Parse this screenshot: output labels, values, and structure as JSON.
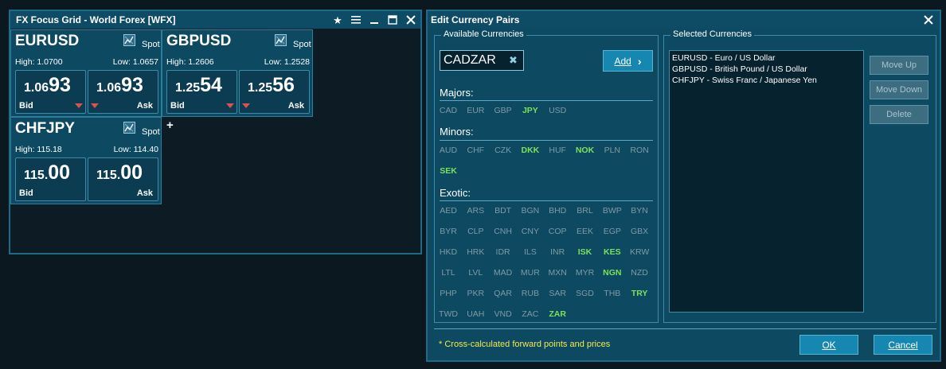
{
  "fx_window": {
    "title": "FX Focus Grid - World Forex [WFX]",
    "controls": [
      "star-icon",
      "menu-icon",
      "minimize-icon",
      "maximize-icon",
      "close-icon"
    ],
    "tiles": [
      {
        "symbol": "EURUSD",
        "spot": "Spot",
        "high": "High: 1.0700",
        "low": "Low: 1.0657",
        "bid": {
          "small": "1.06",
          "big": "93",
          "label": "Bid",
          "tick": "down"
        },
        "ask": {
          "small": "1.06",
          "big": "93",
          "label": "Ask",
          "tick": "down"
        }
      },
      {
        "symbol": "GBPUSD",
        "spot": "Spot",
        "high": "High: 1.2606",
        "low": "Low: 1.2528",
        "bid": {
          "small": "1.25",
          "big": "54",
          "label": "Bid",
          "tick": "down"
        },
        "ask": {
          "small": "1.25",
          "big": "56",
          "label": "Ask",
          "tick": "down"
        }
      },
      {
        "symbol": "CHFJPY",
        "spot": "Spot",
        "high": "High: 115.18",
        "low": "Low: 114.40",
        "bid": {
          "small": "115.",
          "big": "00",
          "label": "Bid",
          "tick": "none"
        },
        "ask": {
          "small": "115.",
          "big": "00",
          "label": "Ask",
          "tick": "none"
        }
      }
    ],
    "add_tile": "+"
  },
  "dialog": {
    "title": "Edit Currency Pairs",
    "available_label": "Available Currencies",
    "selected_label": "Selected Currencies",
    "input_value": "CADZAR",
    "add_label": "Add",
    "categories": [
      {
        "name": "Majors:",
        "currencies": [
          {
            "code": "CAD",
            "on": false
          },
          {
            "code": "EUR",
            "on": false
          },
          {
            "code": "GBP",
            "on": false
          },
          {
            "code": "JPY",
            "on": true
          },
          {
            "code": "USD",
            "on": false
          }
        ]
      },
      {
        "name": "Minors:",
        "currencies": [
          {
            "code": "AUD",
            "on": false
          },
          {
            "code": "CHF",
            "on": false
          },
          {
            "code": "CZK",
            "on": false
          },
          {
            "code": "DKK",
            "on": true
          },
          {
            "code": "HUF",
            "on": false
          },
          {
            "code": "NOK",
            "on": true
          },
          {
            "code": "PLN",
            "on": false
          },
          {
            "code": "RON",
            "on": false
          },
          {
            "code": "SEK",
            "on": true
          }
        ]
      },
      {
        "name": "Exotic:",
        "currencies": [
          {
            "code": "AED",
            "on": false
          },
          {
            "code": "ARS",
            "on": false
          },
          {
            "code": "BDT",
            "on": false
          },
          {
            "code": "BGN",
            "on": false
          },
          {
            "code": "BHD",
            "on": false
          },
          {
            "code": "BRL",
            "on": false
          },
          {
            "code": "BWP",
            "on": false
          },
          {
            "code": "BYN",
            "on": false
          },
          {
            "code": "BYR",
            "on": false
          },
          {
            "code": "CLP",
            "on": false
          },
          {
            "code": "CNH",
            "on": false
          },
          {
            "code": "CNY",
            "on": false
          },
          {
            "code": "COP",
            "on": false
          },
          {
            "code": "EEK",
            "on": false
          },
          {
            "code": "EGP",
            "on": false
          },
          {
            "code": "GBX",
            "on": false
          },
          {
            "code": "HKD",
            "on": false
          },
          {
            "code": "HRK",
            "on": false
          },
          {
            "code": "IDR",
            "on": false
          },
          {
            "code": "ILS",
            "on": false
          },
          {
            "code": "INR",
            "on": false
          },
          {
            "code": "ISK",
            "on": true
          },
          {
            "code": "KES",
            "on": true
          },
          {
            "code": "KRW",
            "on": false
          },
          {
            "code": "LTL",
            "on": false
          },
          {
            "code": "LVL",
            "on": false
          },
          {
            "code": "MAD",
            "on": false
          },
          {
            "code": "MUR",
            "on": false
          },
          {
            "code": "MXN",
            "on": false
          },
          {
            "code": "MYR",
            "on": false
          },
          {
            "code": "NGN",
            "on": true
          },
          {
            "code": "NZD",
            "on": false
          },
          {
            "code": "PHP",
            "on": false
          },
          {
            "code": "PKR",
            "on": false
          },
          {
            "code": "QAR",
            "on": false
          },
          {
            "code": "RUB",
            "on": false
          },
          {
            "code": "SAR",
            "on": false
          },
          {
            "code": "SGD",
            "on": false
          },
          {
            "code": "THB",
            "on": false
          },
          {
            "code": "TRY",
            "on": true
          },
          {
            "code": "TWD",
            "on": false
          },
          {
            "code": "UAH",
            "on": false
          },
          {
            "code": "VND",
            "on": false
          },
          {
            "code": "ZAC",
            "on": false
          },
          {
            "code": "ZAR",
            "on": true
          }
        ]
      }
    ],
    "selected_items": [
      "EURUSD - Euro / US Dollar",
      "GBPUSD - British Pound / US Dollar",
      "CHFJPY - Swiss Franc / Japanese Yen"
    ],
    "move_up": "Move Up",
    "move_down": "Move Down",
    "delete": "Delete",
    "footnote": "* Cross-calculated forward points and prices",
    "ok": "OK",
    "cancel": "Cancel"
  },
  "colors": {
    "accent": "#1587b0",
    "highlight_currency": "#7ee05a",
    "down_tick": "#e05050",
    "footnote": "#f2e94e"
  }
}
